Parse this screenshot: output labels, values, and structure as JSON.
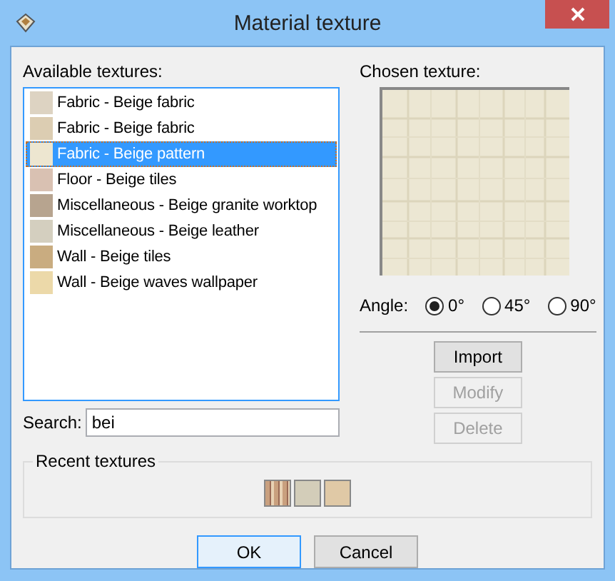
{
  "window": {
    "title": "Material texture"
  },
  "available": {
    "label": "Available textures:",
    "items": [
      {
        "label": "Fabric - Beige fabric",
        "color": "#ddd3c2",
        "selected": false
      },
      {
        "label": "Fabric - Beige fabric",
        "color": "#dccdb2",
        "selected": false
      },
      {
        "label": "Fabric - Beige pattern",
        "color": "#ede6d0",
        "selected": true
      },
      {
        "label": "Floor - Beige tiles",
        "color": "#d9c1b2",
        "selected": false
      },
      {
        "label": "Miscellaneous - Beige granite worktop",
        "color": "#b7a48f",
        "selected": false
      },
      {
        "label": "Miscellaneous - Beige leather",
        "color": "#d4cfbf",
        "selected": false
      },
      {
        "label": "Wall - Beige tiles",
        "color": "#c9ac80",
        "selected": false
      },
      {
        "label": "Wall - Beige waves wallpaper",
        "color": "#ecd9a9",
        "selected": false
      }
    ]
  },
  "search": {
    "label": "Search:",
    "value": "bei"
  },
  "chosen": {
    "label": "Chosen texture:"
  },
  "angle": {
    "label": "Angle:",
    "options": [
      {
        "label": "0°",
        "selected": true
      },
      {
        "label": "45°",
        "selected": false
      },
      {
        "label": "90°",
        "selected": false
      }
    ]
  },
  "side_buttons": [
    {
      "label": "Import",
      "disabled": false
    },
    {
      "label": "Modify",
      "disabled": true
    },
    {
      "label": "Delete",
      "disabled": true
    }
  ],
  "recent": {
    "label": "Recent textures",
    "items": [
      {
        "kind": "striped",
        "color": "#c9a07e"
      },
      {
        "kind": "plain",
        "color": "#d3cdb9"
      },
      {
        "kind": "plain",
        "color": "#e0c9a6"
      }
    ]
  },
  "buttons": [
    {
      "label": "OK",
      "default": true
    },
    {
      "label": "Cancel",
      "default": false
    }
  ]
}
